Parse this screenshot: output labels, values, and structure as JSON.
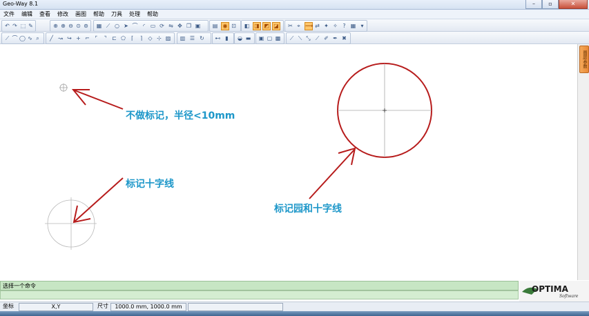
{
  "window": {
    "title": "Geo-Way 8.1",
    "buttons": [
      "–",
      "▫",
      "✕"
    ]
  },
  "menu": [
    "文件",
    "编辑",
    "查看",
    "修改",
    "画图",
    "帮助",
    "刀具",
    "处理",
    "帮助"
  ],
  "canvas": {
    "annotations": {
      "small_marker": "不做标记，半径<10mm",
      "cross_marker": "标记十字线",
      "circle_cross_marker": "标记园和十字线"
    }
  },
  "side_tab": {
    "label": "图层/参数"
  },
  "command": {
    "prompt": "选择一个命令",
    "input": ""
  },
  "logo": {
    "name": "OPTIMA",
    "sub": "Software"
  },
  "status": {
    "coord_label": "坐标",
    "coord_value": "X,Y",
    "size_label": "尺寸",
    "size_value": "1000.0 mm, 1000.0 mm"
  },
  "colors": {
    "annotation_text": "#1d97c9",
    "arrow": "#b71c1c",
    "circle": "#b71c1c",
    "crosshair": "#a6a6a6"
  }
}
